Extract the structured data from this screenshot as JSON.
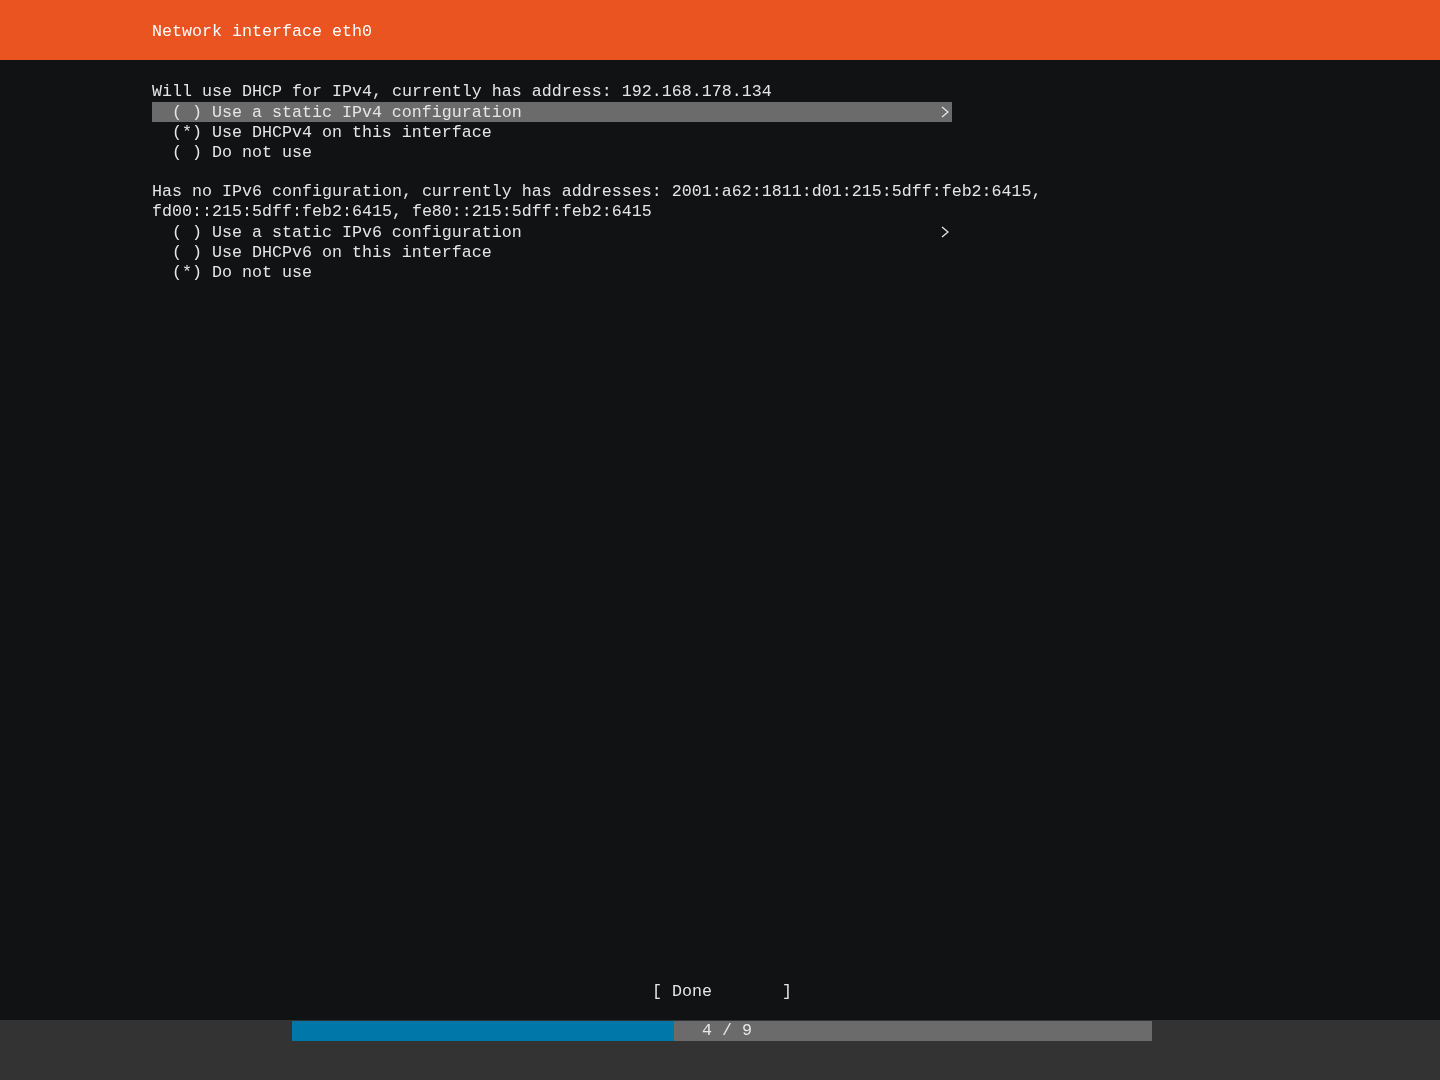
{
  "header": {
    "title": "Network interface eth0"
  },
  "sections": [
    {
      "description": "Will use DHCP for IPv4, currently has address: 192.168.178.134",
      "options": [
        {
          "marker": "( )",
          "label": "Use a static IPv4 configuration",
          "selected": true,
          "submenu": true
        },
        {
          "marker": "(*)",
          "label": "Use DHCPv4 on this interface",
          "selected": false,
          "submenu": false
        },
        {
          "marker": "( )",
          "label": "Do not use",
          "selected": false,
          "submenu": false
        }
      ]
    },
    {
      "description": "Has no IPv6 configuration, currently has addresses: 2001:a62:1811:d01:215:5dff:feb2:6415, fd00::215:5dff:feb2:6415, fe80::215:5dff:feb2:6415",
      "options": [
        {
          "marker": "( )",
          "label": "Use a static IPv6 configuration",
          "selected": false,
          "submenu": true
        },
        {
          "marker": "( )",
          "label": "Use DHCPv6 on this interface",
          "selected": false,
          "submenu": false
        },
        {
          "marker": "(*)",
          "label": "Do not use",
          "selected": false,
          "submenu": false
        }
      ]
    }
  ],
  "done_button": {
    "label": "[ Done       ]"
  },
  "progress": {
    "level": 0.444,
    "label": "4 / 9"
  }
}
